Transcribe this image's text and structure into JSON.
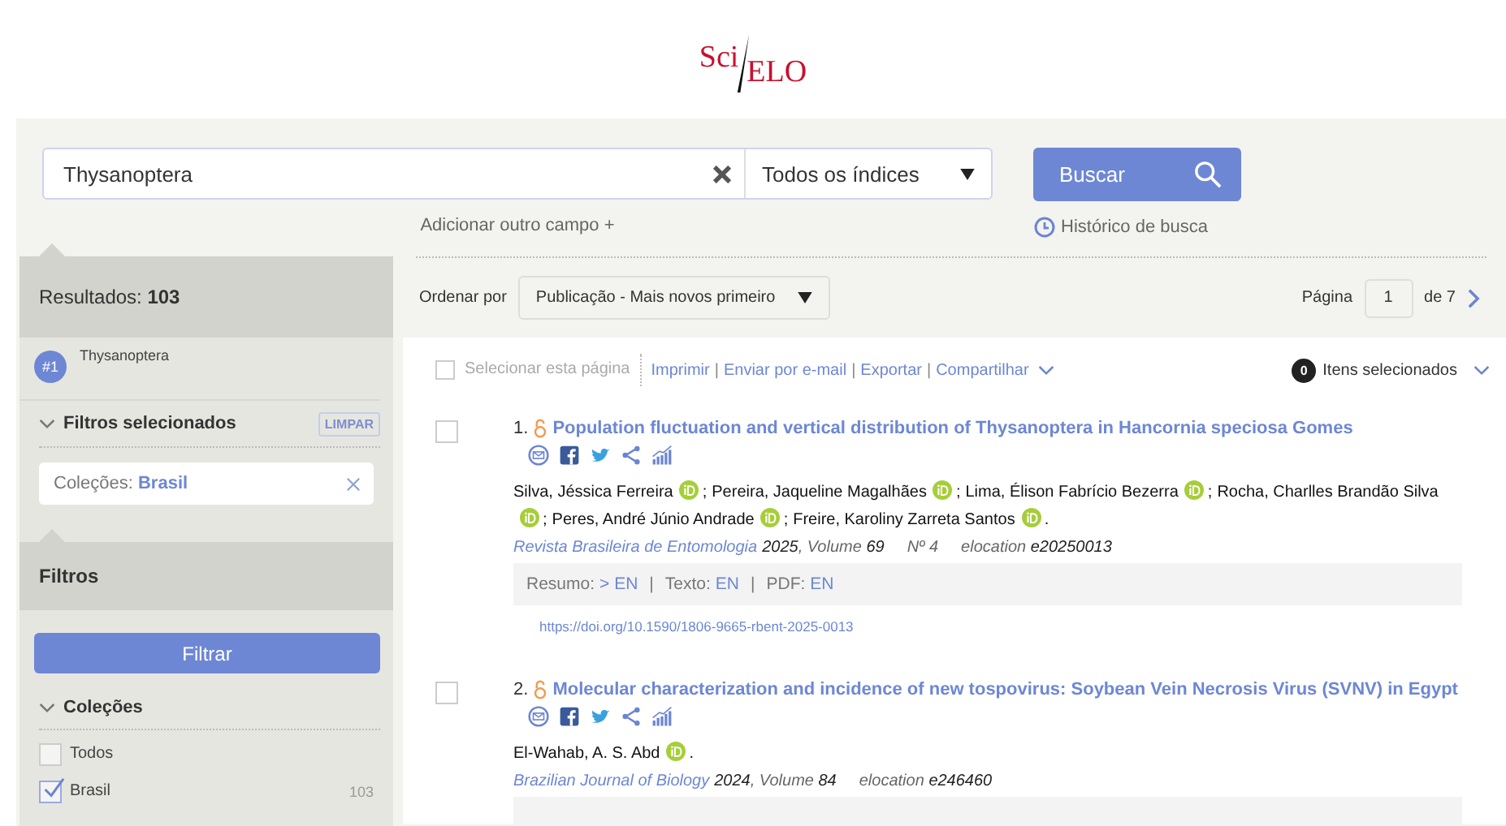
{
  "logo": {
    "left": "Sci",
    "right": "ELO"
  },
  "search": {
    "value": "Thysanoptera",
    "index": "Todos os índices",
    "button": "Buscar",
    "add_field": "Adicionar outro campo +",
    "history": "Histórico de busca"
  },
  "sidebar": {
    "results": "Resultados: **103**",
    "query": {
      "badge": "#1",
      "text": "Thysanoptera"
    },
    "selected_filters": {
      "title": "Filtros selecionados",
      "expanded": true,
      "clear": "LIMPAR",
      "chips": [
        {
          "label": "Coleções:",
          "value": "Brasil"
        }
      ]
    },
    "filters": {
      "title": "Filtros",
      "button": "Filtrar",
      "groups": [
        {
          "title": "Coleções",
          "expanded": true,
          "options": [
            {
              "label": "Todos",
              "checked": false
            },
            {
              "label": "Brasil",
              "checked": true,
              "count": "103"
            }
          ]
        }
      ]
    }
  },
  "sort": {
    "label": "Ordenar por",
    "value": "Publicação - Mais novos primeiro"
  },
  "pagination": {
    "label": "Página",
    "page": "1",
    "total": "de 7"
  },
  "toolbar": {
    "select_page": {
      "label": "Selecionar esta página",
      "checked": false
    },
    "actions": [
      "Imprimir",
      "Enviar por e-mail",
      "Exportar",
      "Compartilhar"
    ],
    "separator": "|",
    "selected_count": "0",
    "selected_label": "Itens selecionados"
  },
  "results": [
    {
      "number": "1.",
      "checked": false,
      "open_access": true,
      "title": "Population fluctuation and vertical distribution of Thysanoptera in Hancornia speciosa Gomes",
      "authors": [
        {
          "name": "Silva, Jéssica Ferreira",
          "orcid": true,
          "after": ";"
        },
        {
          "name": "Pereira, Jaqueline Magalhães",
          "orcid": true,
          "after": ";"
        },
        {
          "name": "Lima, Élison Fabrício Bezerra",
          "orcid": true,
          "after": ";"
        },
        {
          "name": "Rocha, Charlles Brandão Silva",
          "orcid": true,
          "after": ";"
        },
        {
          "name": "Peres, André Júnio Andrade",
          "orcid": true,
          "after": ";"
        },
        {
          "name": "Freire, Karoliny Zarreta Santos",
          "orcid": true,
          "after": "."
        }
      ],
      "journal": "Revista Brasileira de Entomologia",
      "year": "2025",
      "volume_label": ", Volume",
      "volume": "69",
      "issue": "Nº 4",
      "elocation_label": "elocation",
      "elocation": "e20250013",
      "access": [
        {
          "label": "Resumo:",
          "link": "> EN"
        },
        {
          "label": "Texto:",
          "link": "EN"
        },
        {
          "label": "PDF:",
          "link": "EN"
        }
      ],
      "doi": "https://doi.org/10.1590/1806-9665-rbent-2025-0013"
    },
    {
      "number": "2.",
      "checked": false,
      "open_access": true,
      "title": "Molecular characterization and incidence of new tospovirus: Soybean Vein Necrosis Virus (SVNV) in Egypt",
      "authors": [
        {
          "name": "El-Wahab, A. S. Abd",
          "orcid": true,
          "after": "."
        }
      ],
      "journal": "Brazilian Journal of Biology",
      "year": "2024",
      "volume_label": ", Volume",
      "volume": "84",
      "elocation_label": "elocation",
      "elocation": "e246460"
    }
  ]
}
